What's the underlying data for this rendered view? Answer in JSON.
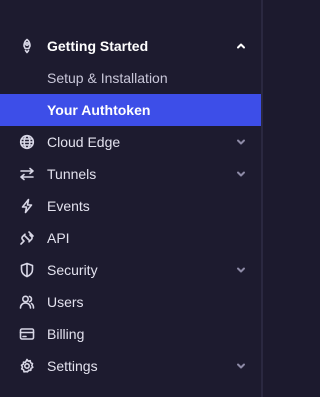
{
  "sidebar": {
    "getting_started": {
      "label": "Getting Started",
      "icon": "rocket-icon",
      "expanded": true,
      "children": [
        {
          "label": "Setup & Installation"
        },
        {
          "label": "Your Authtoken",
          "active": true
        }
      ]
    },
    "items": [
      {
        "label": "Cloud Edge",
        "icon": "globe-icon",
        "expandable": true
      },
      {
        "label": "Tunnels",
        "icon": "arrows-swap-icon",
        "expandable": true
      },
      {
        "label": "Events",
        "icon": "lightning-icon",
        "expandable": false
      },
      {
        "label": "API",
        "icon": "plug-icon",
        "expandable": false
      },
      {
        "label": "Security",
        "icon": "shield-icon",
        "expandable": true
      },
      {
        "label": "Users",
        "icon": "users-icon",
        "expandable": false
      },
      {
        "label": "Billing",
        "icon": "credit-card-icon",
        "expandable": false
      },
      {
        "label": "Settings",
        "icon": "gear-icon",
        "expandable": true
      }
    ]
  },
  "colors": {
    "background": "#1d1b2f",
    "active": "#3d4ee8",
    "text": "#e3e2ee"
  }
}
